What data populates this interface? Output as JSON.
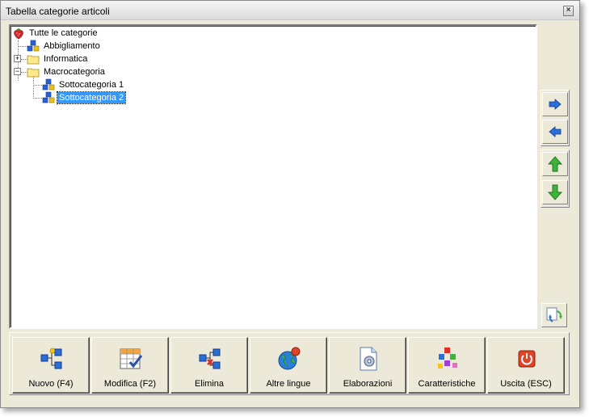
{
  "window": {
    "title": "Tabella categorie articoli",
    "close_glyph": "×"
  },
  "tree": {
    "root": {
      "label": "Tutte le categorie",
      "icon": "strawberry-icon"
    },
    "items": [
      {
        "label": "Abbigliamento",
        "icon": "category-cubes-icon",
        "level": 1,
        "expander": ""
      },
      {
        "label": "Informatica",
        "icon": "folder-icon",
        "level": 1,
        "expander": "+"
      },
      {
        "label": "Macrocategoria",
        "icon": "folder-icon",
        "level": 1,
        "expander": "−"
      },
      {
        "label": "Sottocategoria 1",
        "icon": "category-cubes-icon",
        "level": 2,
        "expander": ""
      },
      {
        "label": "Sottocategoria 2",
        "icon": "category-cubes-icon",
        "level": 2,
        "expander": "",
        "selected": true
      }
    ]
  },
  "side_buttons": [
    {
      "name": "move-right-button",
      "icon": "arrow-right-blue-icon"
    },
    {
      "name": "move-left-button",
      "icon": "arrow-left-blue-icon"
    },
    {
      "name": "move-up-button",
      "icon": "arrow-up-green-icon"
    },
    {
      "name": "move-down-button",
      "icon": "arrow-down-green-icon"
    },
    {
      "name": "refresh-tree-button",
      "icon": "refresh-icon"
    }
  ],
  "buttons": {
    "new": "Nuovo (F4)",
    "edit": "Modifica (F2)",
    "delete": "Elimina",
    "languages": "Altre lingue",
    "processing": "Elaborazioni",
    "features": "Caratteristiche",
    "exit": "Uscita (ESC)"
  },
  "colors": {
    "window_bg": "#ece9d8",
    "selection": "#3399ff",
    "arrow_blue": "#2a6fd6",
    "arrow_green": "#3cb43c",
    "exit_red": "#e0452a"
  }
}
